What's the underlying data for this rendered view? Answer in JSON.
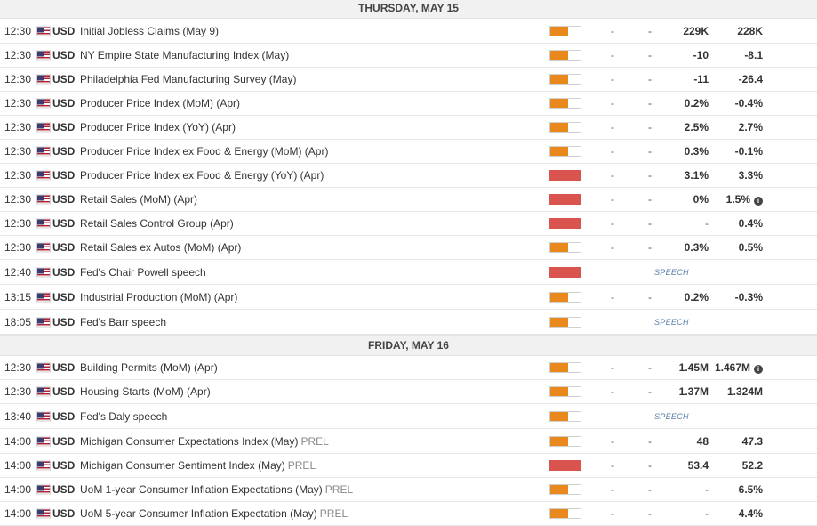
{
  "days": [
    {
      "label": "THURSDAY, MAY 15",
      "events": [
        {
          "time": "12:30",
          "currency": "USD",
          "name": "Initial Jobless Claims (May 9)",
          "prel": "",
          "impact": "medium",
          "actual": "-",
          "consensus": "-",
          "previous": "229K",
          "forecast": "228K",
          "speech": "",
          "info": false
        },
        {
          "time": "12:30",
          "currency": "USD",
          "name": "NY Empire State Manufacturing Index (May)",
          "prel": "",
          "impact": "medium",
          "actual": "-",
          "consensus": "-",
          "previous": "-10",
          "forecast": "-8.1",
          "speech": "",
          "info": false
        },
        {
          "time": "12:30",
          "currency": "USD",
          "name": "Philadelphia Fed Manufacturing Survey (May)",
          "prel": "",
          "impact": "medium",
          "actual": "-",
          "consensus": "-",
          "previous": "-11",
          "forecast": "-26.4",
          "speech": "",
          "info": false
        },
        {
          "time": "12:30",
          "currency": "USD",
          "name": "Producer Price Index (MoM) (Apr)",
          "prel": "",
          "impact": "medium",
          "actual": "-",
          "consensus": "-",
          "previous": "0.2%",
          "forecast": "-0.4%",
          "speech": "",
          "info": false
        },
        {
          "time": "12:30",
          "currency": "USD",
          "name": "Producer Price Index (YoY) (Apr)",
          "prel": "",
          "impact": "medium",
          "actual": "-",
          "consensus": "-",
          "previous": "2.5%",
          "forecast": "2.7%",
          "speech": "",
          "info": false
        },
        {
          "time": "12:30",
          "currency": "USD",
          "name": "Producer Price Index ex Food & Energy (MoM) (Apr)",
          "prel": "",
          "impact": "medium",
          "actual": "-",
          "consensus": "-",
          "previous": "0.3%",
          "forecast": "-0.1%",
          "speech": "",
          "info": false
        },
        {
          "time": "12:30",
          "currency": "USD",
          "name": "Producer Price Index ex Food & Energy (YoY) (Apr)",
          "prel": "",
          "impact": "high",
          "actual": "-",
          "consensus": "-",
          "previous": "3.1%",
          "forecast": "3.3%",
          "speech": "",
          "info": false
        },
        {
          "time": "12:30",
          "currency": "USD",
          "name": "Retail Sales (MoM) (Apr)",
          "prel": "",
          "impact": "high",
          "actual": "-",
          "consensus": "-",
          "previous": "0%",
          "forecast": "1.5%",
          "speech": "",
          "info": true
        },
        {
          "time": "12:30",
          "currency": "USD",
          "name": "Retail Sales Control Group (Apr)",
          "prel": "",
          "impact": "high",
          "actual": "-",
          "consensus": "-",
          "previous": "-",
          "forecast": "0.4%",
          "speech": "",
          "info": false
        },
        {
          "time": "12:30",
          "currency": "USD",
          "name": "Retail Sales ex Autos (MoM) (Apr)",
          "prel": "",
          "impact": "medium",
          "actual": "-",
          "consensus": "-",
          "previous": "0.3%",
          "forecast": "0.5%",
          "speech": "",
          "info": false
        },
        {
          "time": "12:40",
          "currency": "USD",
          "name": "Fed's Chair Powell speech",
          "prel": "",
          "impact": "high",
          "actual": "",
          "consensus": "",
          "previous": "",
          "forecast": "",
          "speech": "SPEECH",
          "info": false
        },
        {
          "time": "13:15",
          "currency": "USD",
          "name": "Industrial Production (MoM) (Apr)",
          "prel": "",
          "impact": "medium",
          "actual": "-",
          "consensus": "-",
          "previous": "0.2%",
          "forecast": "-0.3%",
          "speech": "",
          "info": false
        },
        {
          "time": "18:05",
          "currency": "USD",
          "name": "Fed's Barr speech",
          "prel": "",
          "impact": "medium",
          "actual": "",
          "consensus": "",
          "previous": "",
          "forecast": "",
          "speech": "SPEECH",
          "info": false
        }
      ]
    },
    {
      "label": "FRIDAY, MAY 16",
      "events": [
        {
          "time": "12:30",
          "currency": "USD",
          "name": "Building Permits (MoM) (Apr)",
          "prel": "",
          "impact": "medium",
          "actual": "-",
          "consensus": "-",
          "previous": "1.45M",
          "forecast": "1.467M",
          "speech": "",
          "info": true
        },
        {
          "time": "12:30",
          "currency": "USD",
          "name": "Housing Starts (MoM) (Apr)",
          "prel": "",
          "impact": "medium",
          "actual": "-",
          "consensus": "-",
          "previous": "1.37M",
          "forecast": "1.324M",
          "speech": "",
          "info": false
        },
        {
          "time": "13:40",
          "currency": "USD",
          "name": "Fed's Daly speech",
          "prel": "",
          "impact": "medium",
          "actual": "",
          "consensus": "",
          "previous": "",
          "forecast": "",
          "speech": "SPEECH",
          "info": false
        },
        {
          "time": "14:00",
          "currency": "USD",
          "name": "Michigan Consumer Expectations Index (May)",
          "prel": "PREL",
          "impact": "medium",
          "actual": "-",
          "consensus": "-",
          "previous": "48",
          "forecast": "47.3",
          "speech": "",
          "info": false
        },
        {
          "time": "14:00",
          "currency": "USD",
          "name": "Michigan Consumer Sentiment Index (May)",
          "prel": "PREL",
          "impact": "high",
          "actual": "-",
          "consensus": "-",
          "previous": "53.4",
          "forecast": "52.2",
          "speech": "",
          "info": false
        },
        {
          "time": "14:00",
          "currency": "USD",
          "name": "UoM 1-year Consumer Inflation Expectations (May)",
          "prel": "PREL",
          "impact": "medium",
          "actual": "-",
          "consensus": "-",
          "previous": "-",
          "forecast": "6.5%",
          "speech": "",
          "info": false
        },
        {
          "time": "14:00",
          "currency": "USD",
          "name": "UoM 5-year Consumer Inflation Expectation (May)",
          "prel": "PREL",
          "impact": "medium",
          "actual": "-",
          "consensus": "-",
          "previous": "-",
          "forecast": "4.4%",
          "speech": "",
          "info": false
        }
      ]
    }
  ],
  "icons": {
    "flag": "us-flag-icon",
    "info": "info-icon"
  },
  "info_glyph": "i",
  "colors": {
    "impact_medium": "#e8891d",
    "impact_high": "#d9534f",
    "speech": "#5b7fa8",
    "header_bg": "#f1f1f1"
  }
}
